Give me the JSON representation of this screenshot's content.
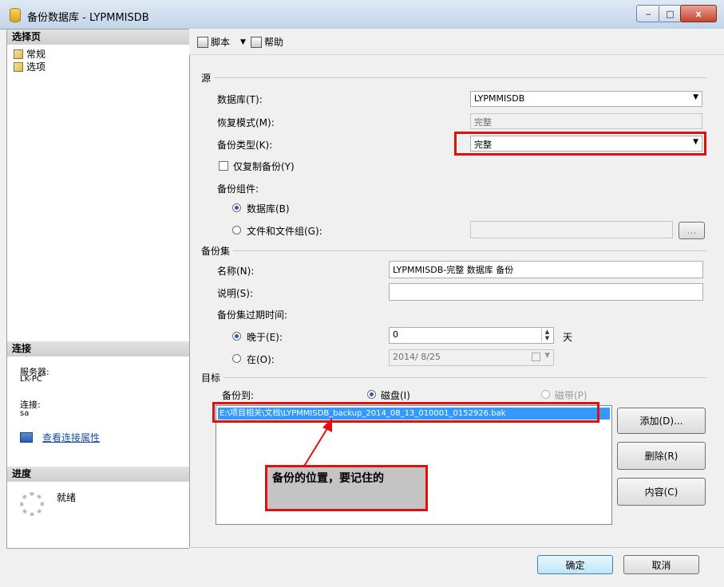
{
  "window": {
    "title": "备份数据库 - LYPMMISDB",
    "minimize": "‒",
    "maximize": "□",
    "close": "x"
  },
  "left": {
    "select_page_header": "选择页",
    "pages": [
      {
        "label": "常规"
      },
      {
        "label": "选项"
      }
    ],
    "connection_header": "连接",
    "server_label": "服务器:",
    "server_value": "LK-PC",
    "connect_label": "连接:",
    "connect_value": "sa",
    "view_props_link": "查看连接属性",
    "progress_header": "进度",
    "progress_status": "就绪"
  },
  "toolbar": {
    "script_label": "脚本",
    "help_label": "帮助"
  },
  "source": {
    "section": "源",
    "database_label": "数据库(T):",
    "database_value": "LYPMMISDB",
    "recovery_label": "恢复模式(M):",
    "recovery_value": "完整",
    "backup_type_label": "备份类型(K):",
    "backup_type_value": "完整",
    "copy_only_label": "仅复制备份(Y)",
    "component_label": "备份组件:",
    "component_db_label": "数据库(B)",
    "component_files_label": "文件和文件组(G):",
    "ellipsis": "..."
  },
  "backup_set": {
    "section": "备份集",
    "name_label": "名称(N):",
    "name_value": "LYPMMISDB-完整 数据库 备份",
    "desc_label": "说明(S):",
    "desc_value": "",
    "expire_label": "备份集过期时间:",
    "after_label": "晚于(E):",
    "after_value": "0",
    "after_unit": "天",
    "on_label": "在(O):",
    "on_value": "2014/ 8/25"
  },
  "destination": {
    "section": "目标",
    "backup_to_label": "备份到:",
    "disk_label": "磁盘(I)",
    "tape_label": "磁带(P)",
    "paths": [
      "E:\\项目相关\\文档\\LYPMMISDB_backup_2014_08_13_010001_0152926.bak"
    ],
    "add_button": "添加(D)...",
    "remove_button": "删除(R)",
    "contents_button": "内容(C)"
  },
  "annotation": {
    "callout_text": "备份的位置，要记住的"
  },
  "footer": {
    "ok_button": "确定",
    "cancel_button": "取消"
  },
  "colors": {
    "highlight_red": "#e01010",
    "selection_blue": "#3399ff"
  }
}
